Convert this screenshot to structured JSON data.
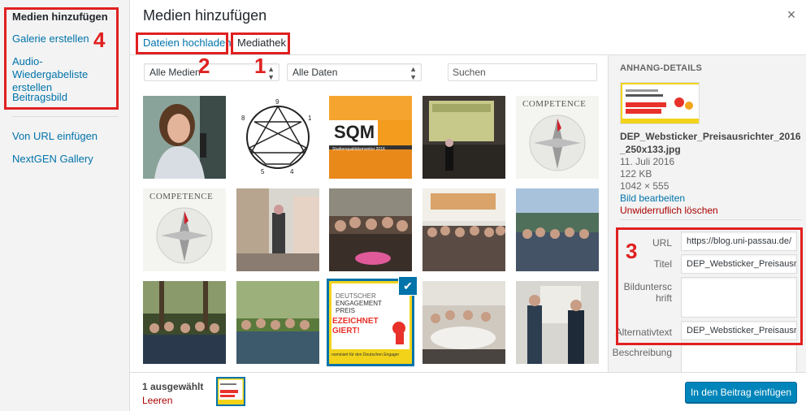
{
  "sidebar": {
    "items": [
      {
        "label": "Medien hinzufügen"
      },
      {
        "label": "Galerie erstellen"
      },
      {
        "label": "Audio-Wiedergabeliste erstellen"
      },
      {
        "label": "Beitragsbild"
      },
      {
        "label": "Von URL einfügen"
      },
      {
        "label": "NextGEN Gallery"
      }
    ]
  },
  "header": {
    "title": "Medien hinzufügen",
    "close_icon": "×"
  },
  "tabs": [
    {
      "label": "Dateien hochladen"
    },
    {
      "label": "Mediathek"
    }
  ],
  "toolbar": {
    "filter_type": "Alle Medien",
    "filter_date": "Alle Daten",
    "search_placeholder": "Suchen"
  },
  "grid": {
    "thumb_text": {
      "sqm": "SQM",
      "sqm_sub": "Studienqualitätsmonitor 2016",
      "competence": "COMPETENCE",
      "dep_line1": "DEUTSCHER",
      "dep_line2": "ENGAGEMENT",
      "dep_line3": "PREIS",
      "dep_award": "EZEICHNET GIERT!",
      "dep_foot": "nominiert für den Deutschen Engager"
    },
    "selected_index": 12,
    "check_icon": "✔"
  },
  "details": {
    "heading": "ANHANG-DETAILS",
    "filename": "DEP_Websticker_Preisausrichter_2016_250x133.jpg",
    "date": "11. Juli 2016",
    "size": "122 KB",
    "dimensions": "1042 × 555",
    "edit_label": "Bild bearbeiten",
    "delete_label": "Unwiderruflich löschen",
    "fields": {
      "url_label": "URL",
      "url_value": "https://blog.uni-passau.de/",
      "title_label": "Titel",
      "title_value": "DEP_Websticker_Preisausric",
      "caption_label": "Bildunterschrift",
      "alt_label": "Alternativtext",
      "alt_value": "DEP_Websticker_Preisausric",
      "desc_label": "Beschreibung"
    }
  },
  "bottom": {
    "selected_count": "1 ausgewählt",
    "clear_label": "Leeren",
    "insert_label": "In den Beitrag einfügen"
  },
  "annotations": {
    "n1": "1",
    "n2": "2",
    "n3": "3",
    "n4": "4"
  },
  "colors": {
    "accent": "#0073aa",
    "annotation_red": "#e02020",
    "primary_button": "#0085ba",
    "delete_red": "#a00"
  }
}
